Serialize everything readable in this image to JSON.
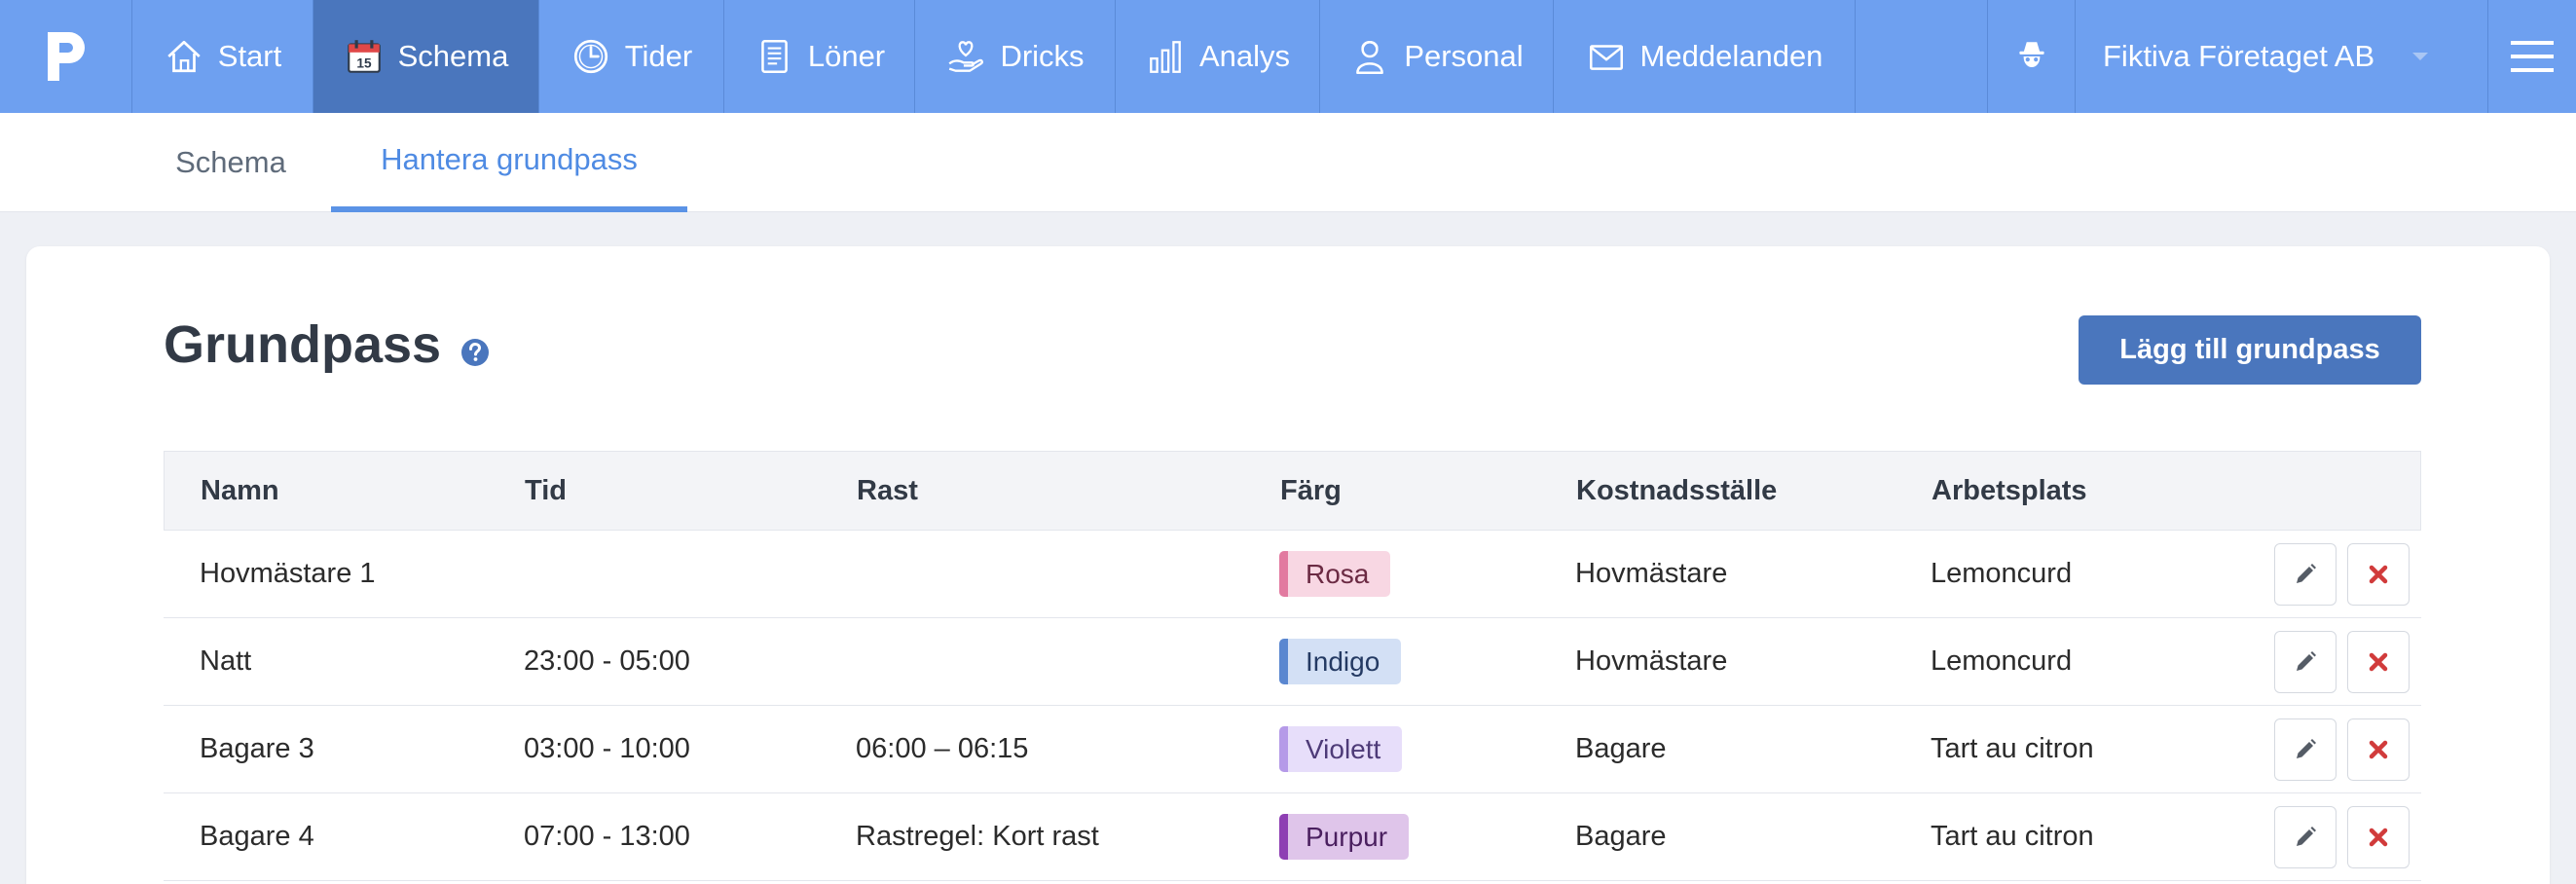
{
  "nav": {
    "logo": "P",
    "items": [
      {
        "label": "Start",
        "icon": "home-icon"
      },
      {
        "label": "Schema",
        "icon": "calendar-icon",
        "active": true,
        "calendar_day": "15"
      },
      {
        "label": "Tider",
        "icon": "clock-icon"
      },
      {
        "label": "Löner",
        "icon": "document-icon"
      },
      {
        "label": "Dricks",
        "icon": "tip-hand-icon"
      },
      {
        "label": "Analys",
        "icon": "bar-chart-icon"
      },
      {
        "label": "Personal",
        "icon": "person-icon"
      },
      {
        "label": "Meddelanden",
        "icon": "envelope-icon"
      }
    ],
    "spy_icon": "incognito-icon",
    "company": "Fiktiva Företaget AB",
    "menu_icon": "hamburger-menu-icon"
  },
  "subnav": {
    "tabs": [
      {
        "label": "Schema",
        "active": false
      },
      {
        "label": "Hantera grundpass",
        "active": true
      }
    ]
  },
  "page": {
    "title": "Grundpass",
    "add_button": "Lägg till grundpass"
  },
  "table": {
    "headers": [
      "Namn",
      "Tid",
      "Rast",
      "Färg",
      "Kostnadsställe",
      "Arbetsplats"
    ],
    "rows": [
      {
        "name": "Hovmästare 1",
        "time": "",
        "break": "",
        "color": "Rosa",
        "cost_center": "Hovmästare",
        "workplace": "Lemoncurd"
      },
      {
        "name": "Natt",
        "time": "23:00 - 05:00",
        "break": "",
        "color": "Indigo",
        "cost_center": "Hovmästare",
        "workplace": "Lemoncurd"
      },
      {
        "name": "Bagare 3",
        "time": "03:00 - 10:00",
        "break": "06:00 – 06:15",
        "color": "Violett",
        "cost_center": "Bagare",
        "workplace": "Tart au citron"
      },
      {
        "name": "Bagare 4",
        "time": "07:00 - 13:00",
        "break": "Rastregel: Kort rast",
        "color": "Purpur",
        "cost_center": "Bagare",
        "workplace": "Tart au citron"
      }
    ]
  },
  "colors": {
    "nav_bg": "#6ea0f0",
    "nav_active": "#4a76bd",
    "accent": "#5b93e6",
    "button": "#4a76bd",
    "delete": "#d13b3b",
    "badges": {
      "Rosa": {
        "bg": "#f8d7e3",
        "stripe": "#e27aa0",
        "text": "#6b2a43"
      },
      "Indigo": {
        "bg": "#d3e0f5",
        "stripe": "#5a87d0",
        "text": "#243a63"
      },
      "Violett": {
        "bg": "#e7defa",
        "stripe": "#b59ae8",
        "text": "#4e3b78"
      },
      "Purpur": {
        "bg": "#dfc5ea",
        "stripe": "#8e3fb3",
        "text": "#4a1f5f"
      }
    }
  }
}
